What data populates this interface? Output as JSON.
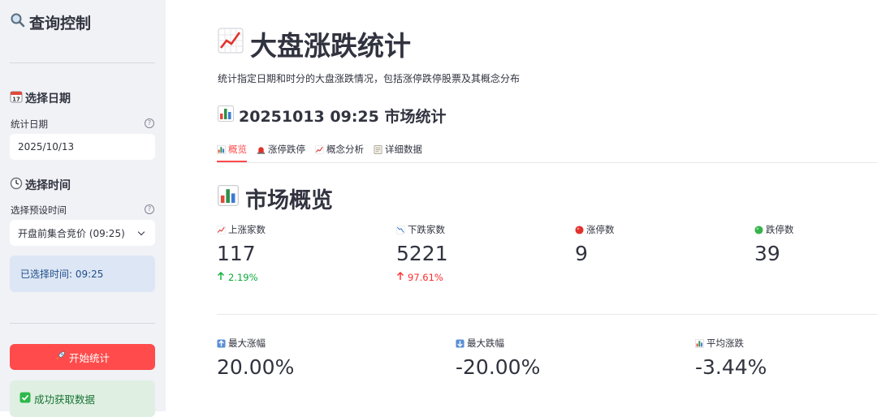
{
  "sidebar": {
    "title": "查询控制",
    "date_section": "选择日期",
    "date_label": "统计日期",
    "date_value": "2025/10/13",
    "time_section": "选择时间",
    "preset_label": "选择预设时间",
    "preset_value": "开盘前集合竞价 (09:25)",
    "selected_info": "已选择时间: 09:25",
    "start_button": "开始统计",
    "success_message": "成功获取数据"
  },
  "main": {
    "title": "大盘涨跌统计",
    "subtitle": "统计指定日期和时分的大盘涨跌情况，包括涨停跌停股票及其概念分布",
    "stats_heading": "20251013 09:25 市场统计",
    "tabs": [
      {
        "label": "概览",
        "icon": "bar-chart-icon",
        "active": true
      },
      {
        "label": "涨停跌停",
        "icon": "siren-icon",
        "active": false
      },
      {
        "label": "概念分析",
        "icon": "chart-up-icon",
        "active": false
      },
      {
        "label": "详细数据",
        "icon": "document-icon",
        "active": false
      }
    ],
    "overview_heading": "市场概览",
    "metrics_row1": [
      {
        "label": "上涨家数",
        "value": "117",
        "delta": "2.19%",
        "delta_color": "green",
        "icon": "chart-up-icon"
      },
      {
        "label": "下跌家数",
        "value": "5221",
        "delta": "97.61%",
        "delta_color": "red",
        "icon": "chart-down-icon"
      },
      {
        "label": "涨停数",
        "value": "9",
        "icon": "red-circle-icon"
      },
      {
        "label": "跌停数",
        "value": "39",
        "icon": "green-circle-icon"
      }
    ],
    "metrics_row2": [
      {
        "label": "最大涨幅",
        "value": "20.00%",
        "icon": "up-arrow-icon"
      },
      {
        "label": "最大跌幅",
        "value": "-20.00%",
        "icon": "down-arrow-icon"
      },
      {
        "label": "平均涨跌",
        "value": "-3.44%",
        "icon": "bar-chart-icon"
      }
    ]
  },
  "colors": {
    "accent": "#ff4b4b",
    "sidebar_bg": "#f0f2f6",
    "info_bg": "#dde6f4",
    "success_bg": "#dff0e2",
    "delta_up": "#09ab3b",
    "delta_down": "#ff2b2b"
  }
}
